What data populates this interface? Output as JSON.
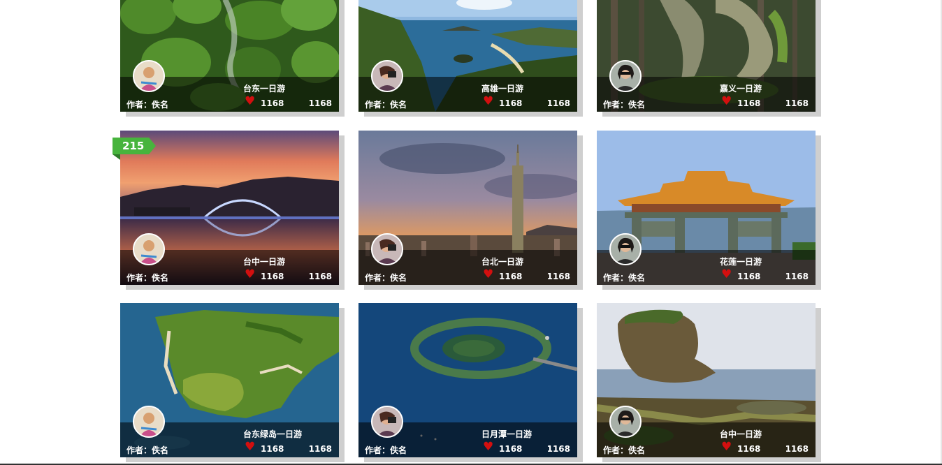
{
  "cards": [
    {
      "destination": "台东一日游",
      "author": "作者：佚名",
      "likes": "1168",
      "views": "1168",
      "icon": "moss-rocks-photo"
    },
    {
      "destination": "高雄一日游",
      "author": "作者：佚名",
      "likes": "1168",
      "views": "1168",
      "icon": "coast-photo"
    },
    {
      "destination": "嘉义一日游",
      "author": "作者：佚名",
      "likes": "1168",
      "views": "1168",
      "icon": "forest-photo"
    },
    {
      "destination": "台中一日游",
      "author": "作者：佚名",
      "likes": "1168",
      "views": "1168",
      "rank": "215",
      "icon": "bridge-sunset-photo"
    },
    {
      "destination": "台北一日游",
      "author": "作者：佚名",
      "likes": "1168",
      "views": "1168",
      "icon": "city-tower-photo"
    },
    {
      "destination": "花莲一日游",
      "author": "作者：佚名",
      "likes": "1168",
      "views": "1168",
      "icon": "temple-gate-photo"
    },
    {
      "destination": "台东绿岛一日游",
      "author": "作者：佚名",
      "likes": "1168",
      "views": "1168",
      "icon": "island-aerial-photo"
    },
    {
      "destination": "日月潭一日游",
      "author": "作者：佚名",
      "likes": "1168",
      "views": "1168",
      "icon": "lake-island-photo"
    },
    {
      "destination": "台中一日游",
      "author": "作者：佚名",
      "likes": "1168",
      "views": "1168",
      "icon": "sea-rock-photo"
    }
  ],
  "colors": {
    "overlay": "rgba(0,0,0,0.55)",
    "heart": "#d30f0f",
    "rank_badge": "#47b43d",
    "active_border": "#83b97f",
    "shadow": "#cfcfcf"
  }
}
